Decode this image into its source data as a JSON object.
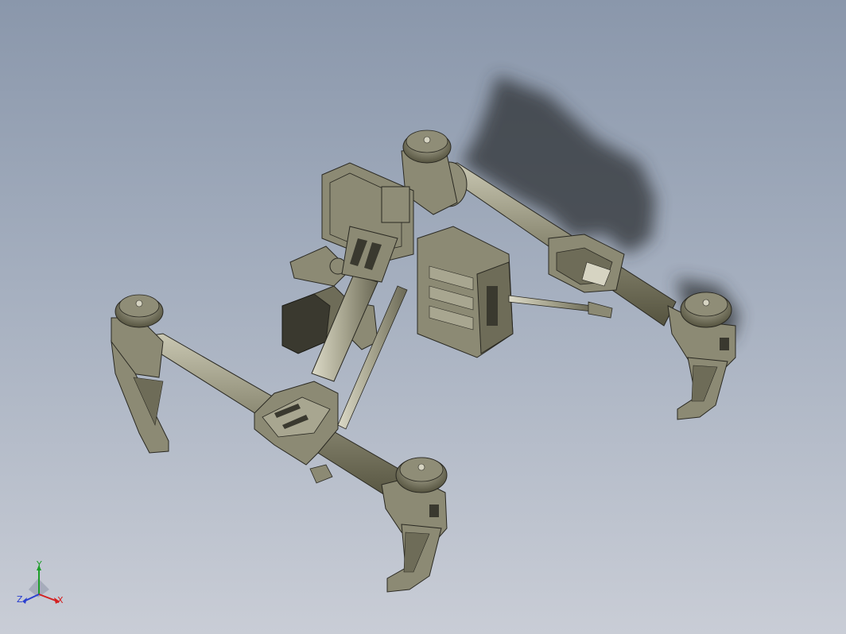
{
  "viewport": {
    "background_top": "#8a97ab",
    "background_bottom": "#c9cdd6",
    "model_color": "#8c8a74",
    "model_shade": "#5f5d4c",
    "model_highlight": "#d6d4c2",
    "edge_color": "#2a2922"
  },
  "triad": {
    "x_label": "X",
    "y_label": "Y",
    "z_label": "Z",
    "x_color": "#d42020",
    "y_color": "#1e9e2a",
    "z_color": "#2a3fd0"
  }
}
